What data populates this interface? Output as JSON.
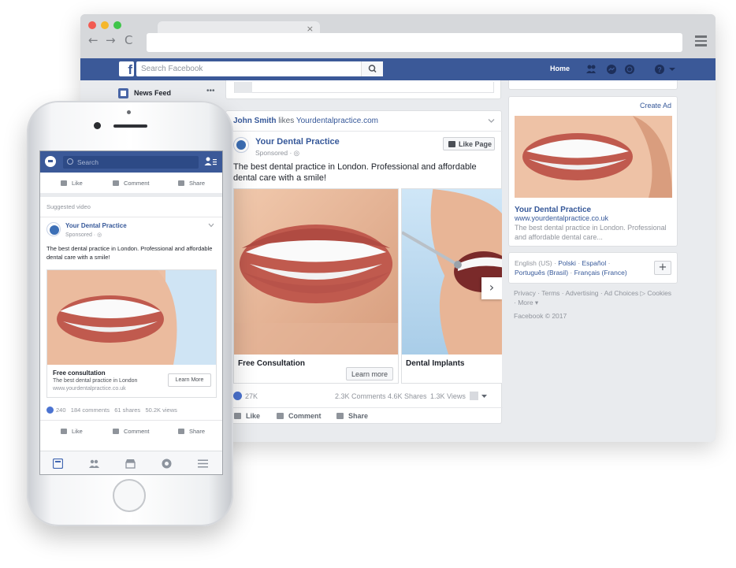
{
  "desktop": {
    "tab_close": "×",
    "nav": {
      "back": "←",
      "forward": "→",
      "reload": "C"
    },
    "fb": {
      "logo": "f",
      "search_placeholder": "Search Facebook",
      "home": "Home"
    },
    "left_nav": {
      "news_feed": "News Feed",
      "more": "•••"
    },
    "post": {
      "story_actor": "John Smith",
      "story_verb": "likes",
      "story_site": "Yourdentalpractice.com",
      "page_name": "Your Dental Practice",
      "sponsored": "Sponsored · ",
      "like_page": "Like Page",
      "text": "The best dental practice in London. Professional and affordable dental care with a smile!",
      "cards": [
        {
          "title": "Free Consultation",
          "cta": "Learn more"
        },
        {
          "title": "Dental Implants"
        }
      ],
      "next_arrow": "›",
      "reactions": {
        "likes": "27K",
        "comments": "2.3K Comments",
        "shares": "4.6K Shares",
        "views": "1.3K Views"
      },
      "actions": {
        "like": "Like",
        "comment": "Comment",
        "share": "Share"
      }
    },
    "ad": {
      "create_ad": "Create Ad",
      "title": "Your Dental Practice",
      "url": "www.yourdentalpractice.co.uk",
      "desc": "The best dental practice in London. Professional and affordable dental care..."
    },
    "languages": {
      "current": "English (US) · ",
      "polski": "Polski",
      "sep1": " · ",
      "espanol": "Español",
      "sep2": " · ",
      "portugues": "Português (Brasil)",
      "sep3": " · ",
      "francais": "Français (France)",
      "plus": "+"
    },
    "footer": {
      "links": "Privacy · Terms · Advertising · Ad Choices ▷ Cookies · More ▾",
      "copyright": "Facebook © 2017"
    }
  },
  "mobile": {
    "search_placeholder": "Search",
    "actions": {
      "like": "Like",
      "comment": "Comment",
      "share": "Share"
    },
    "suggested": "Suggested video",
    "page_name": "Your Dental Practice",
    "sponsored": "Sponsored · ",
    "text": "The best dental practice in London. Professional and affordable dental care with a smile!",
    "link": {
      "title": "Free consultation",
      "desc": "The best dental practice in London",
      "url": "www.yourdentalpractice.co.uk",
      "cta": "Learn More"
    },
    "stats": {
      "likes": "240",
      "comments": "184 comments",
      "shares": "61 shares",
      "views": "50.2K views"
    }
  },
  "colors": {
    "fb_blue": "#3b5998",
    "link_blue": "#365899",
    "feed_bg": "#e9ebee",
    "traffic_red": "#f25b52",
    "traffic_yellow": "#f5b72c",
    "traffic_green": "#3fc54a"
  }
}
